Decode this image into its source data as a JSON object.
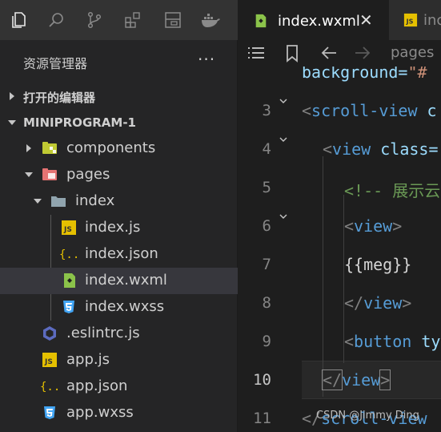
{
  "explorer": {
    "title": "资源管理器",
    "more": "···",
    "sections": {
      "open_editors": "打开的编辑器",
      "project": "MINIPROGRAM-1"
    },
    "tree": {
      "components": "components",
      "pages": "pages",
      "index": "index",
      "index_js": "index.js",
      "index_json": "index.json",
      "index_wxml": "index.wxml",
      "index_wxss": "index.wxss",
      "eslintrc": ".eslintrc.js",
      "app_js": "app.js",
      "app_json": "app.json",
      "app_wxss": "app.wxss"
    }
  },
  "tabs": {
    "active": "index.wxml",
    "close": "✕",
    "second": "inc"
  },
  "breadcrumb": {
    "pages": "pages"
  },
  "editor": {
    "top_partial": {
      "attr": "background=",
      "str": "\"#"
    },
    "line_numbers": [
      "3",
      "4",
      "5",
      "6",
      "7",
      "8",
      "9",
      "10",
      "11"
    ],
    "current_line": "10",
    "lines": {
      "l3": {
        "open": "<",
        "tag": "scroll-view",
        "rest": " c"
      },
      "l4": {
        "open": "<",
        "tag": "view",
        "attr": " class="
      },
      "l5": {
        "comment": "<!-- 展示云"
      },
      "l6": {
        "open": "<",
        "tag": "view",
        "close": ">"
      },
      "l7": {
        "text": "{{meg}}"
      },
      "l8": {
        "open": "</",
        "tag": "view",
        "close": ">"
      },
      "l9": {
        "open": "<",
        "tag": "button",
        "attr": " ty"
      },
      "l10": {
        "open": "</",
        "tag": "view",
        "close": ">"
      },
      "l11": {
        "open": "</",
        "tag": "scroll-view"
      }
    },
    "watermark": "CSDN @Jimmy Ding"
  },
  "colors": {
    "activity_bar": "#333333",
    "sidebar": "#252526",
    "selection": "#37373d",
    "editor_bg": "#1e1e1e",
    "tag": "#569cd6",
    "attr": "#9cdcfe",
    "string": "#ce9178",
    "comment": "#6a9955"
  }
}
